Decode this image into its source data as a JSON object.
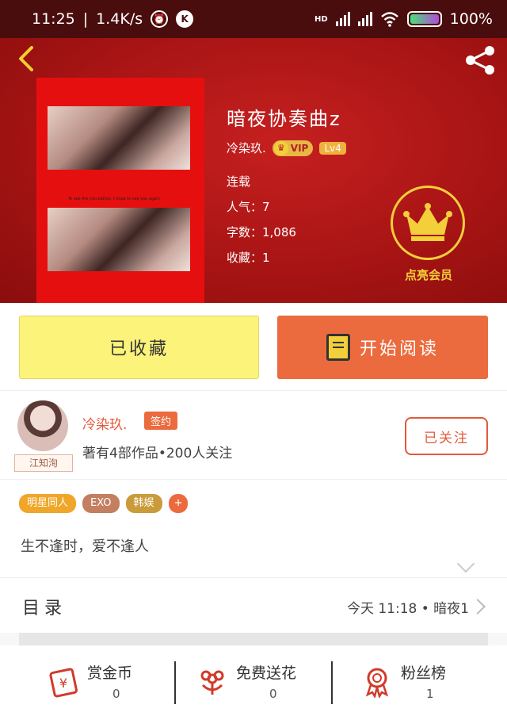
{
  "status_bar": {
    "time": "11:25",
    "speed": "1.4K/s",
    "alarm_icon": "alarm-clock-icon",
    "app_icon_letter": "K",
    "hd_label": "HD",
    "battery": "100%"
  },
  "hero": {
    "title": "暗夜协奏曲z",
    "author": "冷染玖.",
    "vip_label": "VIP",
    "level_label": "Lv4",
    "status": "连载",
    "popularity": "人气：7",
    "word_count": "字数：1,086",
    "favorites": "收藏：1",
    "cover_caption": "To see the you before, I hope to see you again.",
    "member_label": "点亮会员"
  },
  "actions": {
    "favorited_label": "已收藏",
    "read_label": "开始阅读"
  },
  "author_card": {
    "name": "冷染玖.",
    "sign_label": "签约",
    "stats": "著有4部作品•200人关注",
    "avatar_tag": "江知洵",
    "follow_label": "已关注"
  },
  "tags": [
    "明星同人",
    "EXO",
    "韩娱",
    "+"
  ],
  "intro": "生不逢时，爱不逢人",
  "catalog": {
    "title": "目录",
    "latest": "今天 11:18 • 暗夜1"
  },
  "bottom_stats": [
    {
      "label": "赏金币",
      "value": "0",
      "icon": "coin-envelope-icon"
    },
    {
      "label": "免费送花",
      "value": "0",
      "icon": "flower-icon"
    },
    {
      "label": "粉丝榜",
      "value": "1",
      "icon": "medal-icon"
    }
  ],
  "colors": {
    "hero_red": "#a81414",
    "accent_orange": "#ec6b3e",
    "fav_yellow": "#fbf37a",
    "gold": "#f3cf3a"
  }
}
